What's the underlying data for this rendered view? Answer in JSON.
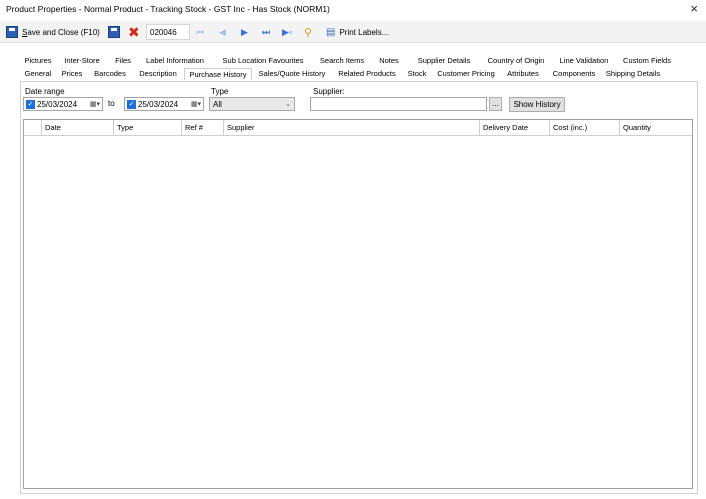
{
  "window": {
    "title": "Product Properties - Normal Product - Tracking Stock - GST Inc - Has Stock (NORM1)",
    "close": "×"
  },
  "toolbar": {
    "save_prefix": "S",
    "save_rest": "ave and Close (F10)",
    "code_value": "020046",
    "print_label": "Print Labels..."
  },
  "tabs_top": [
    "Pictures",
    "Inter-Store",
    "Files",
    "Label Information",
    "Sub Location Favourites",
    "Search Items",
    "Notes",
    "Supplier Details",
    "Country of Origin",
    "Line Validation",
    "Custom Fields"
  ],
  "tabs_bottom": [
    "General",
    "Prices",
    "Barcodes",
    "Description",
    "Purchase History",
    "Sales/Quote History",
    "Related Products",
    "Stock",
    "Customer Pricing",
    "Attributes",
    "Components",
    "Shipping Details"
  ],
  "active_tab": "Purchase History",
  "filters": {
    "date_range_label": "Date range",
    "date_from": "25/03/2024",
    "to_label": "to",
    "date_to": "25/03/2024",
    "type_label": "Type",
    "type_value": "All",
    "supplier_label": "Supplier:",
    "supplier_value": "",
    "browse_label": "...",
    "show_history_label": "Show History"
  },
  "grid": {
    "columns": [
      "Date",
      "Type",
      "Ref #",
      "Supplier",
      "Delivery Date",
      "Cost (inc.)",
      "Quantity"
    ]
  }
}
